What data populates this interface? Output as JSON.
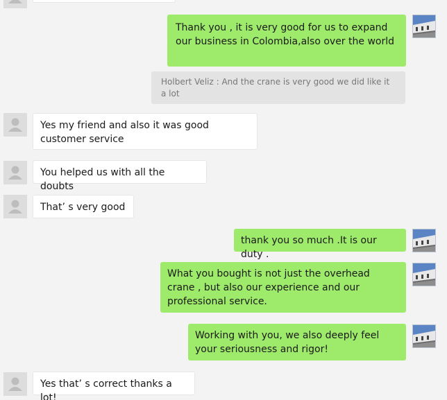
{
  "messages": [
    {
      "text": "Thank you , it is very good for us to expand our business in Colombia,also over the world"
    },
    {
      "text": "Holbert Veliz : And the crane is very good we did like it a lot"
    },
    {
      "text": "Yes my friend and also it was good customer service"
    },
    {
      "text": "You helped us with all the doubts"
    },
    {
      "text": "That’ s very good"
    },
    {
      "text": "thank you so much .It is our duty ."
    },
    {
      "text": "What you bought is not just the overhead crane , but also our experience and our professional service."
    },
    {
      "text": "Working with you, we also deeply feel your seriousness and rigor!"
    },
    {
      "text": "Yes that’ s correct thanks a lot!"
    }
  ],
  "colors": {
    "background": "#f3f3f3",
    "outgoing_bubble": "#9eea6a",
    "incoming_bubble": "#ffffff",
    "quote_bubble": "#e3e3e3"
  },
  "icons": {
    "incoming_avatar": "default-user-avatar-icon",
    "outgoing_avatar": "building-photo-avatar"
  }
}
